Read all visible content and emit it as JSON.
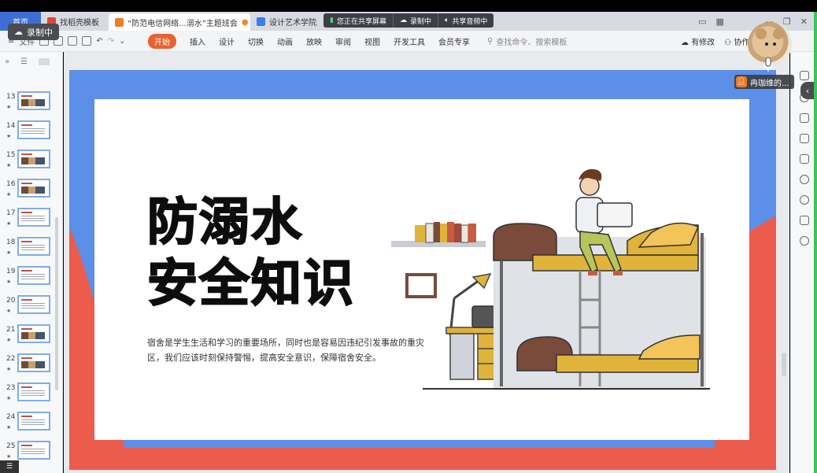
{
  "tabs": {
    "home": "首页",
    "tab1": "找稻壳模板",
    "active": "“防范电信网络...溺水”主题班会",
    "active_dot": "●",
    "tab3": "设计艺术学院xx"
  },
  "share": {
    "sharing": "您正在共享屏幕",
    "recording": "录制中",
    "audio": "共享音频中"
  },
  "rec_badge": "录制中",
  "toolbar": {
    "file": "文件",
    "menu": [
      "开始",
      "插入",
      "设计",
      "切换",
      "动画",
      "放映",
      "审阅",
      "视图",
      "开发工具",
      "会员专享"
    ],
    "search": "查找命令、搜索模板",
    "modify": "有修改",
    "collab": "协作"
  },
  "slides": [
    {
      "num": "13",
      "star": "★",
      "img": true
    },
    {
      "num": "14",
      "star": "★",
      "img": false
    },
    {
      "num": "15",
      "star": "★",
      "img": true
    },
    {
      "num": "16",
      "star": "★",
      "img": true
    },
    {
      "num": "17",
      "star": "★",
      "img": false
    },
    {
      "num": "18",
      "star": "★",
      "img": false
    },
    {
      "num": "19",
      "star": "★",
      "img": false
    },
    {
      "num": "20",
      "star": "★",
      "img": false
    },
    {
      "num": "21",
      "star": "★",
      "img": true
    },
    {
      "num": "22",
      "star": "★",
      "img": true
    },
    {
      "num": "23",
      "star": "★",
      "img": false
    },
    {
      "num": "24",
      "star": "★",
      "img": false
    },
    {
      "num": "25",
      "star": "★",
      "img": false
    }
  ],
  "slide": {
    "title_line1": "防溺水",
    "title_line2": "安全知识",
    "body": "宿舍是学生生活和学习的重要场所，同时也是容易因违纪引发事故的重灾区，我们应该时刻保持警惕，提高安全意识，保障宿舍安全。",
    "colors": {
      "blue": "#5b8fe8",
      "red": "#ec5c4d",
      "white": "#ffffff"
    }
  },
  "participant": "冉珈维的...",
  "icons": [
    "cloud-icon",
    "search-icon",
    "mic-icon",
    "user-icon"
  ]
}
